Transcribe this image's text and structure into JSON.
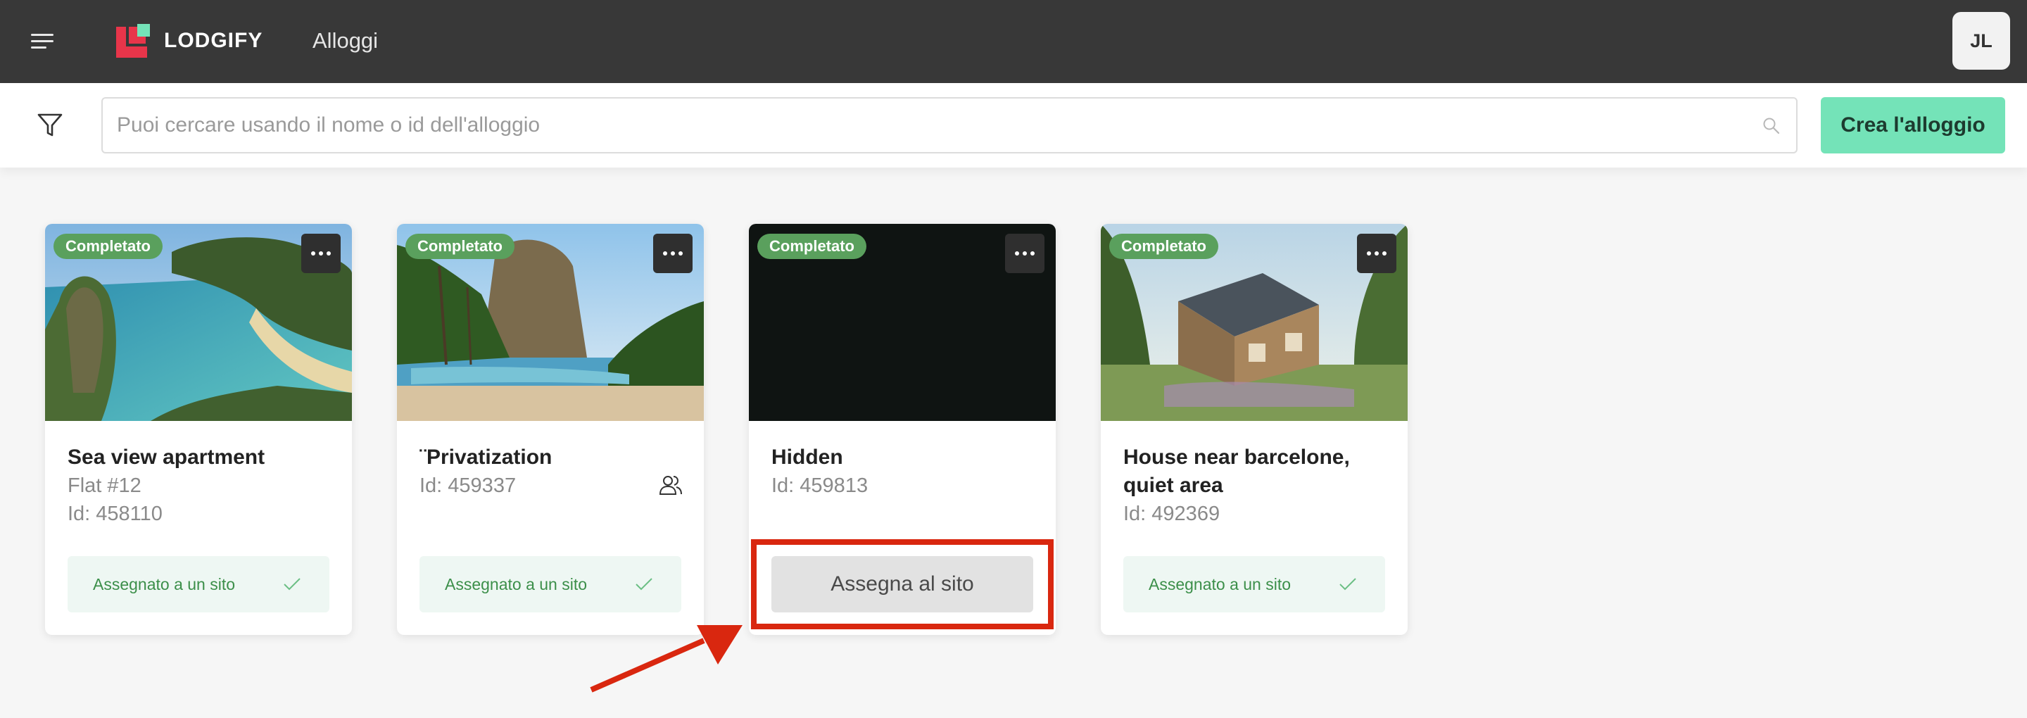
{
  "header": {
    "brand": "LODGIFY",
    "title": "Alloggi",
    "avatar_initials": "JL",
    "colors": {
      "bar": "#383838",
      "logo_red": "#e8354a",
      "logo_green": "#74e3b8"
    }
  },
  "search": {
    "placeholder": "Puoi cercare usando il nome o id dell'alloggio",
    "value": "",
    "create_label": "Crea l'alloggio"
  },
  "properties": [
    {
      "status": "Completato",
      "name": "Sea view apartment",
      "subtitle": "Flat #12",
      "id_text": "Id: 458110",
      "site_label": "Assegnato a un sito",
      "image": "tropical-bay-photo"
    },
    {
      "status": "Completato",
      "name": "¨Privatization",
      "id_text": "Id: 459337",
      "site_label": "Assegnato a un sito",
      "image": "infinity-pool-photo",
      "shared_icon": "group-icon"
    },
    {
      "status": "Completato",
      "name": "Hidden",
      "id_text": "Id: 459813",
      "assign_label": "Assegna al sito",
      "image": "dark-photo"
    },
    {
      "status": "Completato",
      "name": "House near barcelone, quiet area",
      "id_text": "Id: 492369",
      "site_label": "Assegnato a un sito",
      "image": "cabin-photo"
    }
  ],
  "annotation": {
    "color": "#d9270f",
    "target": "assign-site-button"
  }
}
